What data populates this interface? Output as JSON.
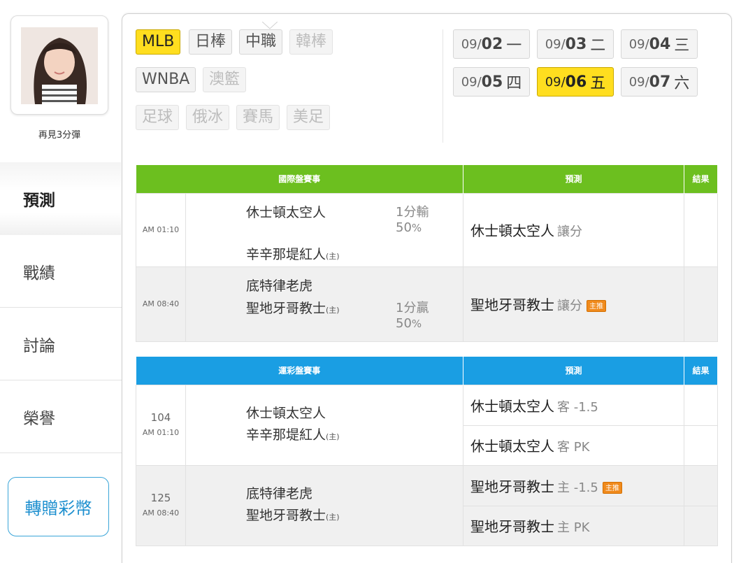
{
  "user": {
    "name": "再見3分彈"
  },
  "nav": {
    "items": [
      {
        "label": "預測"
      },
      {
        "label": "戰績"
      },
      {
        "label": "討論"
      },
      {
        "label": "榮譽"
      }
    ],
    "gift_label": "轉贈彩幣"
  },
  "sports": {
    "row1": [
      "MLB",
      "日棒",
      "中職",
      "韓棒"
    ],
    "row2": [
      "WNBA",
      "澳籃"
    ],
    "row3": [
      "足球",
      "俄冰",
      "賽馬",
      "美足"
    ],
    "active": "MLB"
  },
  "dates": [
    {
      "month": "09/",
      "day": "02",
      "weekday": "一"
    },
    {
      "month": "09/",
      "day": "03",
      "weekday": "二"
    },
    {
      "month": "09/",
      "day": "04",
      "weekday": "三"
    },
    {
      "month": "09/",
      "day": "05",
      "weekday": "四"
    },
    {
      "month": "09/",
      "day": "06",
      "weekday": "五"
    },
    {
      "month": "09/",
      "day": "07",
      "weekday": "六"
    }
  ],
  "intl_table": {
    "headers": {
      "events": "國際盤賽事",
      "prediction": "預測",
      "result": "結果"
    },
    "rows": [
      {
        "time": "AM 01:10",
        "away": "休士頓太空人",
        "home": "辛辛那堤紅人",
        "home_tag": "(主)",
        "odds_line": "1分輸",
        "odds_pct": "50",
        "odds_unit": "%",
        "pick_team": "休士頓太空人",
        "pick_type": "讓分",
        "badge": ""
      },
      {
        "time": "AM 08:40",
        "away": "底特律老虎",
        "home": "聖地牙哥教士",
        "home_tag": "(主)",
        "odds_line": "1分贏",
        "odds_pct": "50",
        "odds_unit": "%",
        "pick_team": "聖地牙哥教士",
        "pick_type": "讓分",
        "badge": "主推"
      }
    ]
  },
  "lotto_table": {
    "headers": {
      "events": "運彩盤賽事",
      "prediction": "預測",
      "result": "結果"
    },
    "rows": [
      {
        "num": "104",
        "time": "AM 01:10",
        "away": "休士頓太空人",
        "home": "辛辛那堤紅人",
        "home_tag": "(主)",
        "picks": [
          {
            "team": "休士頓太空人",
            "line": "客 -1.5",
            "badge": ""
          },
          {
            "team": "休士頓太空人",
            "line": "客 PK",
            "badge": ""
          }
        ]
      },
      {
        "num": "125",
        "time": "AM 08:40",
        "away": "底特律老虎",
        "home": "聖地牙哥教士",
        "home_tag": "(主)",
        "picks": [
          {
            "team": "聖地牙哥教士",
            "line": "主 -1.5",
            "badge": "主推"
          },
          {
            "team": "聖地牙哥教士",
            "line": "主 PK",
            "badge": ""
          }
        ]
      }
    ]
  },
  "colors": {
    "intl_header": "#6cbf1f",
    "lotto_header": "#1a9ee3",
    "active_tab": "#ffde1f",
    "badge": "#f08a1c"
  }
}
